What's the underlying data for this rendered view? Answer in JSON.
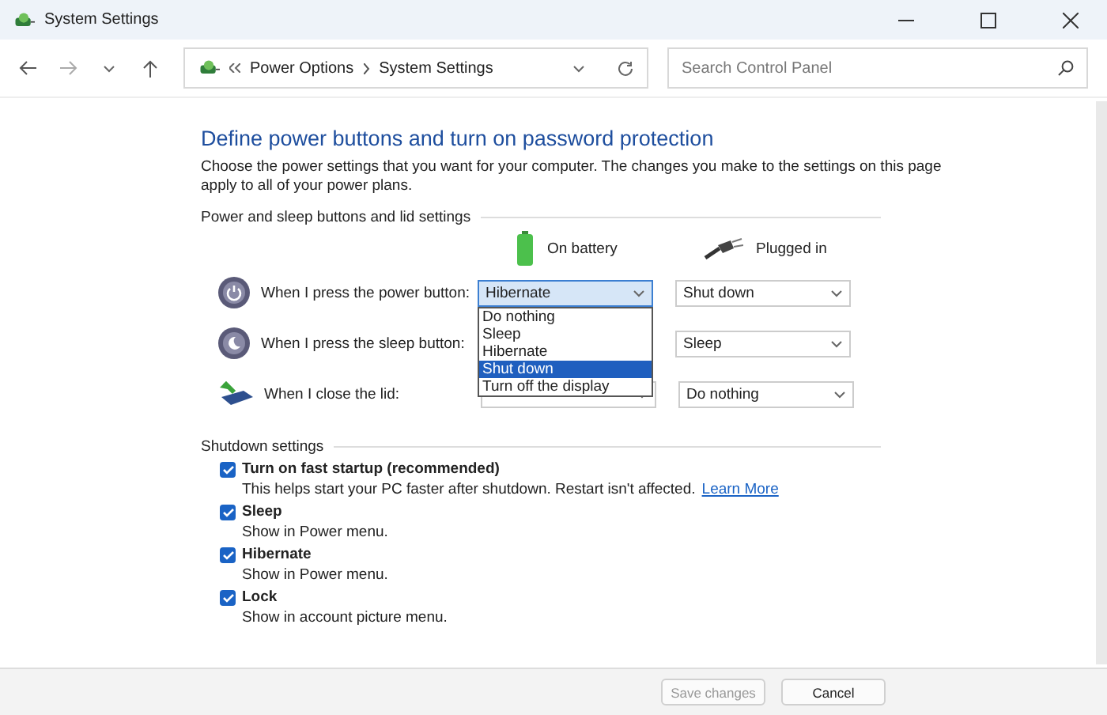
{
  "window": {
    "title": "System Settings"
  },
  "breadcrumb": {
    "items": [
      "Power Options",
      "System Settings"
    ]
  },
  "search": {
    "placeholder": "Search Control Panel"
  },
  "heading": "Define power buttons and turn on password protection",
  "intro": "Choose the power settings that you want for your computer. The changes you make to the settings on this page apply to all of your power plans.",
  "power_section": {
    "title": "Power and sleep buttons and lid settings",
    "columns": [
      {
        "kind": "battery",
        "label": "On battery"
      },
      {
        "kind": "plug",
        "label": "Plugged in"
      }
    ],
    "rows": [
      {
        "kind": "power",
        "label": "When I press the power button:",
        "battery": "Hibernate",
        "plugged": "Shut down",
        "open": true
      },
      {
        "kind": "sleep",
        "label": "When I press the sleep button:",
        "battery": "",
        "plugged": "Sleep",
        "open": false
      },
      {
        "kind": "lid",
        "label": "When I close the lid:",
        "battery": "",
        "plugged": "Do nothing",
        "open": false
      }
    ],
    "menu": [
      {
        "label": "Do nothing",
        "selected": false
      },
      {
        "label": "Sleep",
        "selected": false
      },
      {
        "label": "Hibernate",
        "selected": false
      },
      {
        "label": "Shut down",
        "selected": true
      },
      {
        "label": "Turn off the display",
        "selected": false
      }
    ]
  },
  "shutdown_section": {
    "title": "Shutdown settings",
    "options": [
      {
        "label": "Turn on fast startup (recommended)",
        "checked": true,
        "description": "This helps start your PC faster after shutdown. Restart isn't affected.",
        "link": "Learn More"
      },
      {
        "label": "Sleep",
        "checked": true,
        "description": "Show in Power menu."
      },
      {
        "label": "Hibernate",
        "checked": true,
        "description": "Show in Power menu."
      },
      {
        "label": "Lock",
        "checked": true,
        "description": "Show in account picture menu."
      }
    ]
  },
  "footer": {
    "buttons": [
      {
        "label": "Save changes",
        "disabled": true
      },
      {
        "label": "Cancel",
        "disabled": false
      }
    ]
  }
}
